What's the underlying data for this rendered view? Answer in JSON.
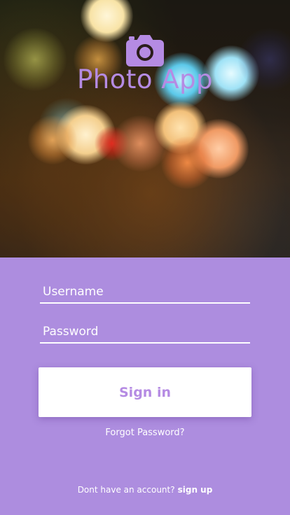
{
  "app": {
    "title": "Photo App",
    "logo_icon": "camera-icon"
  },
  "form": {
    "username": {
      "value": "",
      "placeholder": "Username"
    },
    "password": {
      "value": "",
      "placeholder": "Password"
    },
    "signin_label": "Sign in",
    "forgot_label": "Forgot Password?",
    "signup_prompt": "Dont have an account?",
    "signup_label": "sign up"
  },
  "colors": {
    "accent": "#b58be3",
    "form_background": "#ad8ddf",
    "button_background": "#ffffff",
    "text_light": "#ffffff"
  }
}
